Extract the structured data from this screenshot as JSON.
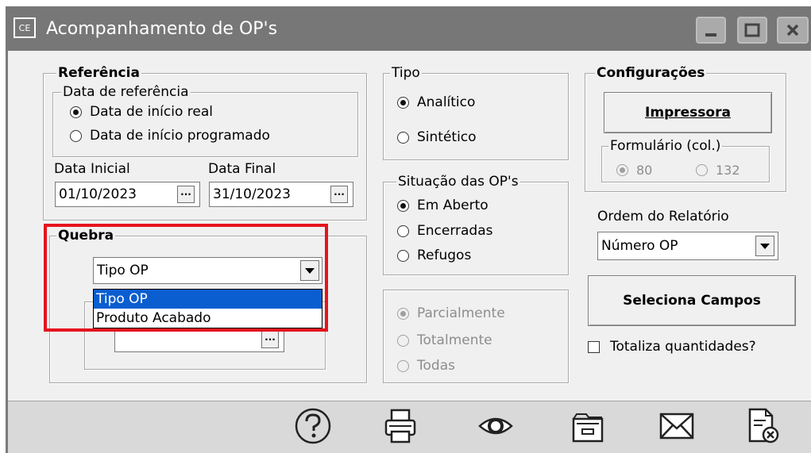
{
  "window": {
    "title": "Acompanhamento de OP's",
    "app_icon_text": "CE",
    "minimize_icon": "minimize-icon",
    "maximize_icon": "maximize-icon",
    "close_icon": "close-icon"
  },
  "referencia": {
    "legend": "Referência",
    "data_ref_legend": "Data de referência",
    "options": [
      "Data de início real",
      "Data de início programado"
    ],
    "selected": 0,
    "data_inicial_label": "Data Inicial",
    "data_inicial_value": "01/10/2023",
    "data_final_label": "Data Final",
    "data_final_value": "31/10/2023",
    "ellipsis": "···"
  },
  "quebra": {
    "legend": "Quebra",
    "selected_value": "Tipo OP",
    "options": [
      "Tipo OP",
      "Produto Acabado"
    ],
    "highlighted": 0,
    "sub_ellipsis": "···"
  },
  "tipo": {
    "legend": "Tipo",
    "options": [
      "Analítico",
      "Sintético"
    ],
    "selected": 0
  },
  "situacao": {
    "legend": "Situação das OP's",
    "options": [
      "Em Aberto",
      "Encerradas",
      "Refugos"
    ],
    "selected": 0
  },
  "parcial": {
    "options": [
      "Parcialmente",
      "Totalmente",
      "Todas"
    ],
    "selected": 0
  },
  "configuracoes": {
    "legend": "Configurações",
    "impressora_label": "Impressora",
    "formulario_legend": "Formulário (col.)",
    "formulario_options": [
      "80",
      "132"
    ],
    "formulario_selected": 0
  },
  "ordem": {
    "label": "Ordem do Relatório",
    "value": "Número OP"
  },
  "seleciona_campos_label": "Seleciona Campos",
  "totaliza_label": "Totaliza quantidades?",
  "footer_icons": [
    "help-icon",
    "print-icon",
    "preview-icon",
    "folder-icon",
    "email-icon",
    "cancel-document-icon"
  ],
  "colors": {
    "titlebar": "#777777",
    "highlight": "#0a5ed0",
    "annotation": "#e5141e"
  }
}
